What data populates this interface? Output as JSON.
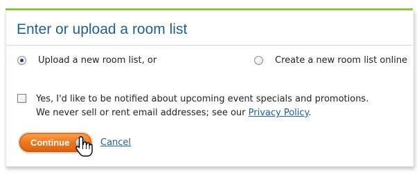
{
  "dialog": {
    "title": "Enter or upload a room list"
  },
  "options": {
    "upload_label": "Upload a new room list, or",
    "create_label": "Create a new room list online",
    "selected": "upload"
  },
  "notify": {
    "line1": "Yes, I'd like to be notified about upcoming event specials and promotions.",
    "line2_prefix": "We never sell or rent email addresses; see our ",
    "privacy_link": "Privacy Policy",
    "line2_suffix": ".",
    "checked": false
  },
  "actions": {
    "continue_label": "Continue",
    "cancel_label": "Cancel"
  },
  "colors": {
    "accent_green": "#8cc63f",
    "title_blue": "#1f5f96",
    "button_orange": "#f07a1f"
  },
  "icons": {
    "button_arrow": "arrow-right-circle-icon",
    "cursor": "hand-pointer-cursor-icon"
  }
}
